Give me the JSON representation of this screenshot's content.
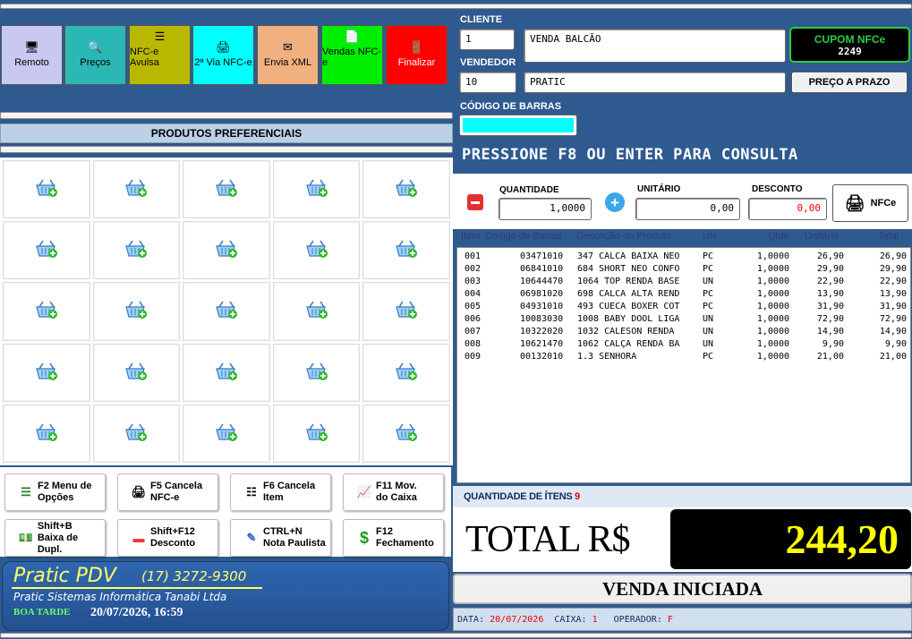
{
  "toolbar": {
    "buttons": [
      {
        "label": "Remoto",
        "color": "#c8c8f0",
        "icon": "monitor-icon"
      },
      {
        "label": "Preços",
        "color": "#2bb7b3",
        "icon": "price-search-icon"
      },
      {
        "label": "NFC-e Avulsa",
        "color": "#b8b800",
        "icon": "document-list-icon"
      },
      {
        "label": "2ª Via NFC-e",
        "color": "#00ffff",
        "icon": "printer-icon"
      },
      {
        "label": "Envia XML",
        "color": "#f0b080",
        "icon": "email-icon"
      },
      {
        "label": "Vendas NFC-e",
        "color": "#00ee00",
        "icon": "report-icon"
      },
      {
        "label": "Finalizar",
        "color": "#ff0000",
        "icon": "exit-door-icon"
      }
    ]
  },
  "favorites": {
    "title": "PRODUTOS PREFERENCIAIS",
    "icon": "basket-add-icon",
    "count": 25
  },
  "function_keys": [
    {
      "label": "F2 Menu de\nOpções",
      "icon": "menu-list-icon"
    },
    {
      "label": "F5 Cancela\nNFC-e",
      "icon": "cancel-invoice-icon"
    },
    {
      "label": "F6 Cancela\nItem",
      "icon": "cancel-item-icon"
    },
    {
      "label": "F11 Mov.\ndo Caixa",
      "icon": "cash-movement-icon"
    },
    {
      "label": "Shift+B\nBaixa de Dupl.",
      "icon": "money-icon"
    },
    {
      "label": "Shift+F12\nDesconto",
      "icon": "minus-red-icon"
    },
    {
      "label": "CTRL+N\nNota Paulista",
      "icon": "note-edit-icon"
    },
    {
      "label": "F12\nFechamento",
      "icon": "dollar-icon"
    }
  ],
  "brand": {
    "name": "Pratic PDV",
    "phone": "(17) 3272-9300",
    "company": "Pratic Sistemas Informática Tanabi Ltda",
    "greeting": "BOA TARDE",
    "datetime": "20/07/2026, 16:59"
  },
  "sale": {
    "cliente_label": "CLIENTE",
    "cliente_code": "1",
    "cliente_name": "VENDA BALCÃO",
    "vendedor_label": "VENDEDOR",
    "vendedor_code": "10",
    "vendedor_name": "PRATIC",
    "cupom_title": "CUPOM NFCe",
    "cupom_number": "2249",
    "prazo_button": "PREÇO A PRAZO",
    "barcode_label": "CÓDIGO DE BARRAS",
    "barcode_value": "",
    "prompt": "PRESSIONE F8 OU ENTER PARA CONSULTA",
    "qty_label": "QUANTIDADE",
    "qty_value": "1,0000",
    "unit_label": "UNITÁRIO",
    "unit_value": "0,00",
    "disc_label": "DESCONTO",
    "disc_value": "0,00",
    "nfce_button": "NFCe"
  },
  "table": {
    "headers": [
      "Ítem",
      "Código de Barras",
      "Descrição do Produto",
      "UN",
      "Qtde",
      "Unitário",
      "Total"
    ],
    "rows": [
      [
        "001",
        "03471010",
        "347 CALCA BAIXA NEO",
        "PC",
        "1,0000",
        "26,90",
        "26,90"
      ],
      [
        "002",
        "06841010",
        "684 SHORT NEO CONFO",
        "PC",
        "1,0000",
        "29,90",
        "29,90"
      ],
      [
        "003",
        "10644470",
        "1064 TOP RENDA BASE",
        "UN",
        "1,0000",
        "22,90",
        "22,90"
      ],
      [
        "004",
        "06981020",
        "698 CALCA ALTA REND",
        "PC",
        "1,0000",
        "13,90",
        "13,90"
      ],
      [
        "005",
        "04931010",
        "493 CUECA BOXER COT",
        "PC",
        "1,0000",
        "31,90",
        "31,90"
      ],
      [
        "006",
        "10083030",
        "1008 BABY DOOL LIGA",
        "UN",
        "1,0000",
        "72,90",
        "72,90"
      ],
      [
        "007",
        "10322020",
        "1032 CALESON RENDA",
        "UN",
        "1,0000",
        "14,90",
        "14,90"
      ],
      [
        "008",
        "10621470",
        "1062 CALÇA RENDA BA",
        "UN",
        "1,0000",
        "9,90",
        "9,90"
      ],
      [
        "009",
        "00132010",
        "1.3 SENHORA",
        "PC",
        "1,0000",
        "21,00",
        "21,00"
      ]
    ]
  },
  "summary": {
    "qty_items_label": "QUANTIDADE DE ÍTENS",
    "qty_items": "9",
    "total_label": "TOTAL R$",
    "total_value": "244,20",
    "status": "VENDA INICIADA",
    "date_label": "DATA:",
    "date": "20/07/2026",
    "caixa_label": "CAIXA:",
    "caixa": "1",
    "operador_label": "OPERADOR:",
    "operador": "F"
  }
}
